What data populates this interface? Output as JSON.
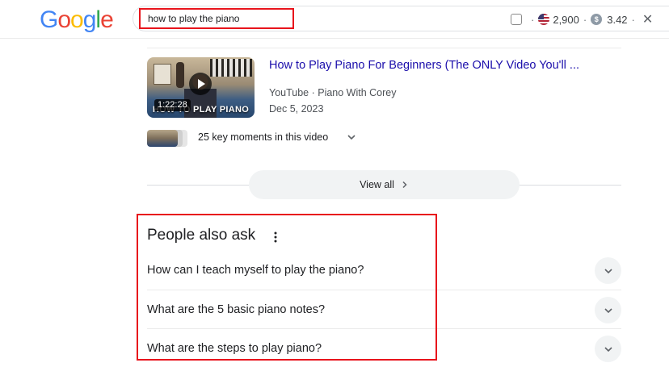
{
  "header": {
    "logo_letters": [
      "G",
      "o",
      "o",
      "g",
      "l",
      "e"
    ],
    "logo_colors": [
      "#4285F4",
      "#EA4335",
      "#FBBC05",
      "#4285F4",
      "#34A853",
      "#EA4335"
    ],
    "search_query": "how to play the piano",
    "extension": {
      "checkbox_checked": false,
      "separator": "·",
      "volume": "2,900",
      "cpc": "3.42",
      "dollar_glyph": "$",
      "close_glyph": "✕",
      "flag_icon": "us-flag-icon"
    }
  },
  "video_result": {
    "title": "How to Play Piano For Beginners (The ONLY Video You'll ...",
    "source": "YouTube · Piano With Corey",
    "date": "Dec 5, 2023",
    "duration": "1:22:28",
    "thumbnail_banner": "HOW TO PLAY PIANO",
    "key_moments_label": "25 key moments in this video"
  },
  "view_all": {
    "label": "View all"
  },
  "people_also_ask": {
    "title": "People also ask",
    "questions": [
      "How can I teach myself to play the piano?",
      "What are the 5 basic piano notes?",
      "What are the steps to play piano?"
    ]
  },
  "colors": {
    "link": "#1a0dab",
    "highlight": "#e8141c",
    "chip_bg": "#f1f3f4"
  }
}
